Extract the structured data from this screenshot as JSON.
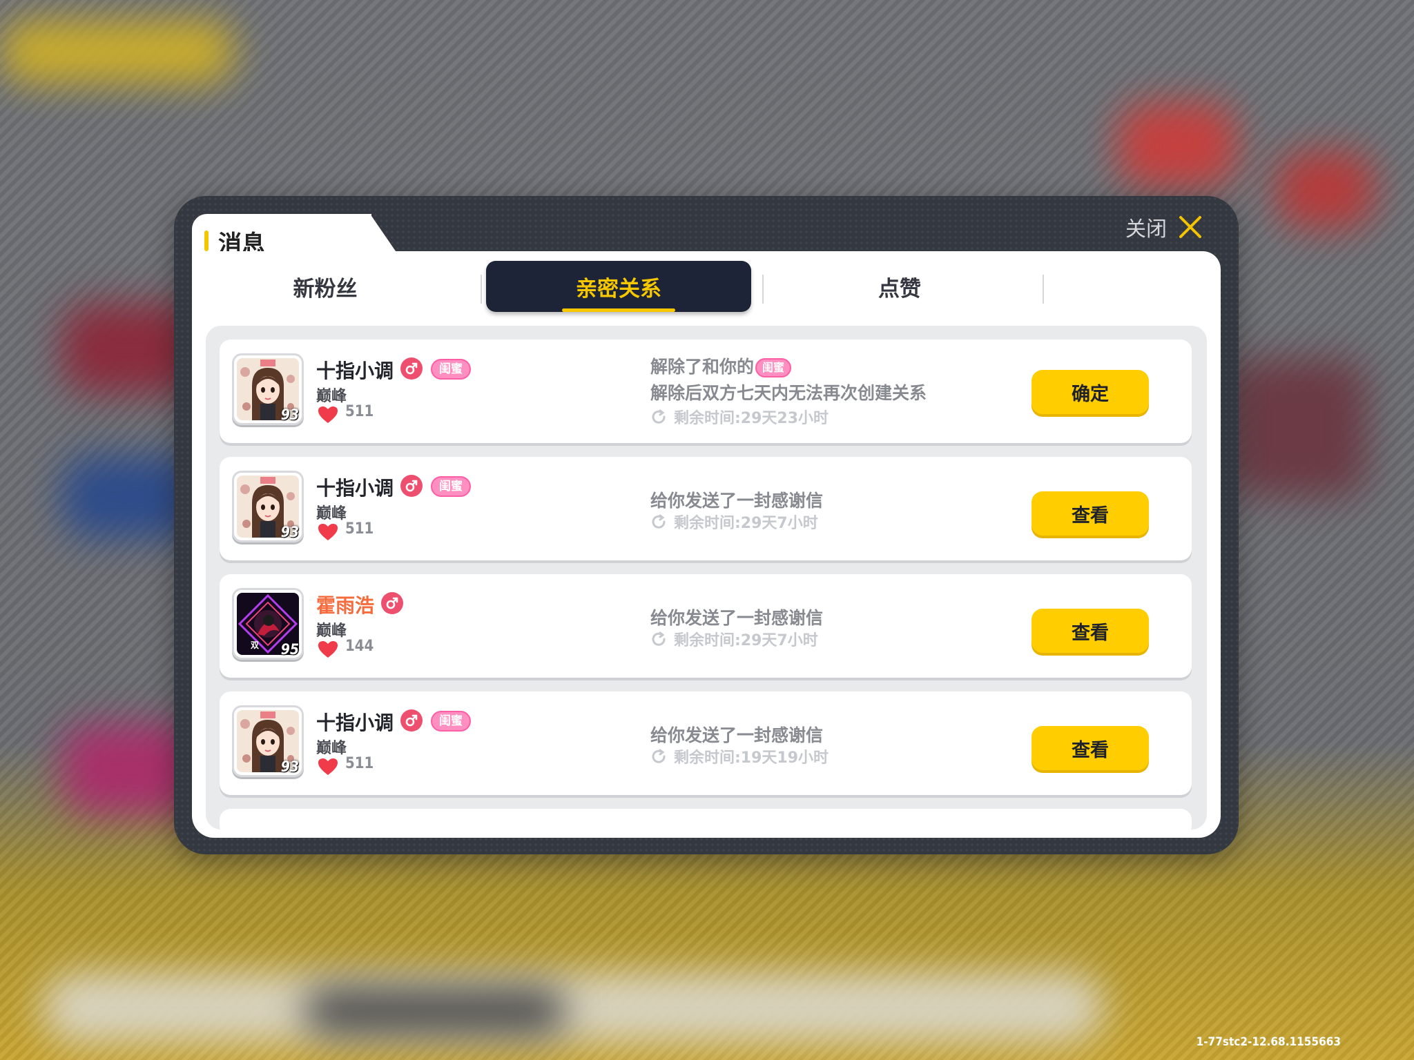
{
  "dialog": {
    "title": "消息",
    "close_label": "关闭"
  },
  "tabs": [
    {
      "label": "新粉丝",
      "active": false
    },
    {
      "label": "亲密关系",
      "active": true
    },
    {
      "label": "点赞",
      "active": false
    }
  ],
  "messages": [
    {
      "name": "十指小调",
      "name_color": "default",
      "gender_icon": "male-icon",
      "relation_badge": "闺蜜",
      "rank": "巅峰",
      "hearts": "511",
      "level": "93",
      "message_prefix": "解除了和你的",
      "message_badge": "闺蜜",
      "message_line2": "解除后双方七天内无法再次创建关系",
      "timer": "剩余时间:29天23小时",
      "action": "确定"
    },
    {
      "name": "十指小调",
      "name_color": "default",
      "gender_icon": "male-icon",
      "relation_badge": "闺蜜",
      "rank": "巅峰",
      "hearts": "511",
      "level": "93",
      "message_prefix": "给你发送了一封感谢信",
      "timer": "剩余时间:29天7小时",
      "action": "查看"
    },
    {
      "name": "霍雨浩",
      "name_color": "orange",
      "gender_icon": "male-icon",
      "rank": "巅峰",
      "hearts": "144",
      "level": "95",
      "message_prefix": "给你发送了一封感谢信",
      "timer": "剩余时间:29天7小时",
      "action": "查看"
    },
    {
      "name": "十指小调",
      "name_color": "default",
      "gender_icon": "male-icon",
      "relation_badge": "闺蜜",
      "rank": "巅峰",
      "hearts": "511",
      "level": "93",
      "message_prefix": "给你发送了一封感谢信",
      "timer": "剩余时间:19天19小时",
      "action": "查看"
    }
  ],
  "version_text": "1-77stc2-12.68.1155663",
  "colors": {
    "accent": "#ffcd00",
    "tab_active_bg": "#1d2438",
    "tab_active_text": "#f7c800",
    "badge_pink": "#ff8ec1",
    "name_orange": "#f56b3c"
  }
}
